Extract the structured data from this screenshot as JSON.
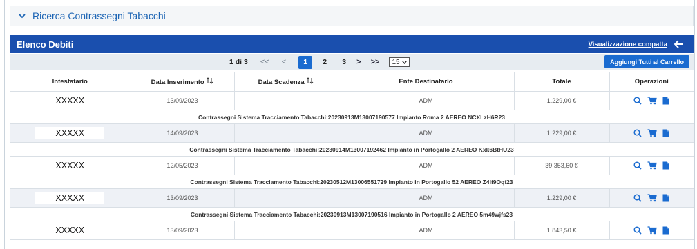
{
  "search_panel": {
    "title": "Ricerca Contrassegni Tabacchi"
  },
  "debts": {
    "title": "Elenco Debiti",
    "compact_view_link": "Visualizzazione compatta",
    "pagination": {
      "page_info": "1 di 3",
      "first": "<<",
      "prev": "<",
      "pages": [
        "1",
        "2",
        "3"
      ],
      "current_page": "1",
      "next": ">",
      "last": ">>",
      "page_size": "15"
    },
    "add_all_button": "Aggiungi Tutti al Carrello",
    "columns": [
      "Intestatario",
      "Data Inserimento",
      "Data Scadenza",
      "Ente Destinatario",
      "Totale",
      "Operazioni"
    ],
    "rows": [
      {
        "holder": "XXXXX",
        "inserted": "13/09/2023",
        "due": "",
        "entity": "ADM",
        "total": "1.229,00 €",
        "description": "Contrassegni Sistema Tracciamento Tabacchi:20230913M13007190577 Impianto Roma 2 AEREO NCXLzH6R23"
      },
      {
        "holder": "XXXXX",
        "inserted": "14/09/2023",
        "due": "",
        "entity": "ADM",
        "total": "1.229,00 €",
        "description": "Contrassegni Sistema Tracciamento Tabacchi:20230914M13007192462 Impianto in Portogallo 2 AEREO Kxk6BtHU23"
      },
      {
        "holder": "XXXXX",
        "inserted": "12/05/2023",
        "due": "",
        "entity": "ADM",
        "total": "39.353,60 €",
        "description": "Contrassegni Sistema Tracciamento Tabacchi:20230512M13006551729 Impianto in Portogallo 52 AEREO Z4If9Oqf23"
      },
      {
        "holder": "XXXXX",
        "inserted": "13/09/2023",
        "due": "",
        "entity": "ADM",
        "total": "1.229,00 €",
        "description": "Contrassegni Sistema Tracciamento Tabacchi:20230913M13007190516 Impianto in Portogallo 2 AEREO 5m49wjfs23"
      },
      {
        "holder": "XXXXX",
        "inserted": "13/09/2023",
        "due": "",
        "entity": "ADM",
        "total": "1.843,50 €"
      }
    ],
    "icons": {
      "view": "search-icon",
      "cart": "cart-icon",
      "doc": "document-icon",
      "sort": "sort-icon"
    },
    "colors": {
      "header_bg": "#1a4fae",
      "accent": "#1a6bd0",
      "link": "#1c64b4",
      "alt_row": "#eef1f6"
    }
  }
}
